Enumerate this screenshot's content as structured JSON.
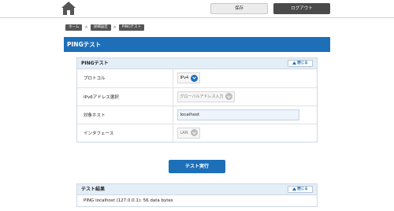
{
  "header": {
    "save_label": "保存",
    "logout_label": "ログアウト"
  },
  "breadcrumb": [
    "ホーム",
    "詳細設定",
    "PINGテスト"
  ],
  "breadcrumb_separator": ">",
  "page_title": "PINGテスト",
  "ping_panel": {
    "title": "PINGテスト",
    "close_label": "閉じる",
    "rows": {
      "protocol": {
        "label": "プロトコル",
        "value": "IPv4"
      },
      "ipv6_address": {
        "label": "IPv6アドレス選択",
        "value": "グローバルアドレス入力"
      },
      "target_host": {
        "label": "対象ホスト",
        "value": "localhost"
      },
      "interface": {
        "label": "インタフェース",
        "value": "LAN"
      }
    }
  },
  "run_button_label": "テスト実行",
  "result_panel": {
    "title": "テスト結果",
    "close_label": "閉じる",
    "output": "PING localhost (127.0.0.1): 56 data bytes"
  },
  "colors": {
    "accent": "#1d6fb8",
    "panel_header": "#e4eef7",
    "logout_button": "#4a4a4a"
  },
  "icons": [
    "home-icon",
    "chevron-down-icon",
    "chevron-up-icon"
  ]
}
